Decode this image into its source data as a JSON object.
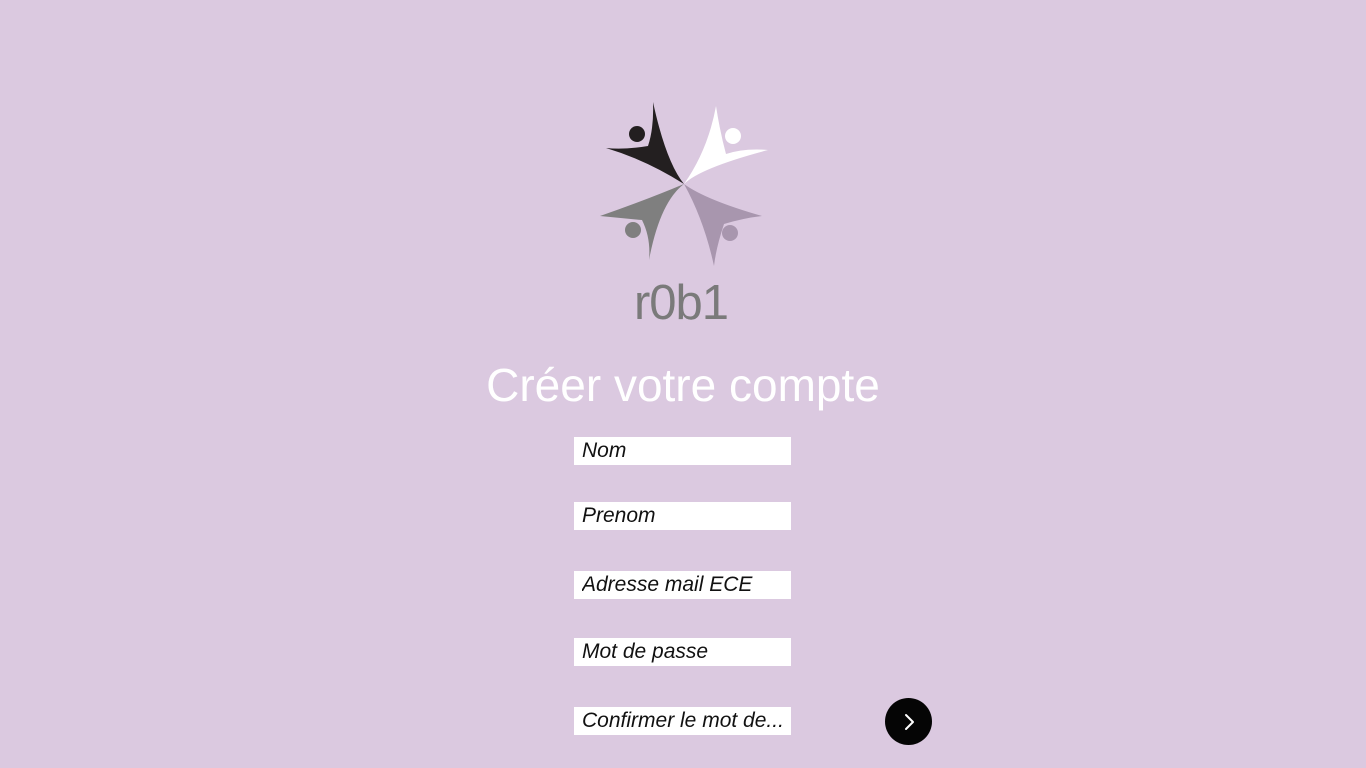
{
  "brand": {
    "name": "r0b1",
    "logo_icon": "pinwheel-figures-logo",
    "logo_colors": [
      "#231f20",
      "#ffffff",
      "#7f7f7f",
      "#a896ae"
    ]
  },
  "page": {
    "title": "Créer votre compte",
    "background_color": "#dbc9e0"
  },
  "form": {
    "nom_placeholder": "Nom",
    "prenom_placeholder": "Prenom",
    "email_placeholder": "Adresse mail ECE",
    "password_placeholder": "Mot de passe",
    "confirm_password_placeholder": "Confirmer le mot de..."
  },
  "actions": {
    "next_icon": "chevron-right-icon"
  }
}
